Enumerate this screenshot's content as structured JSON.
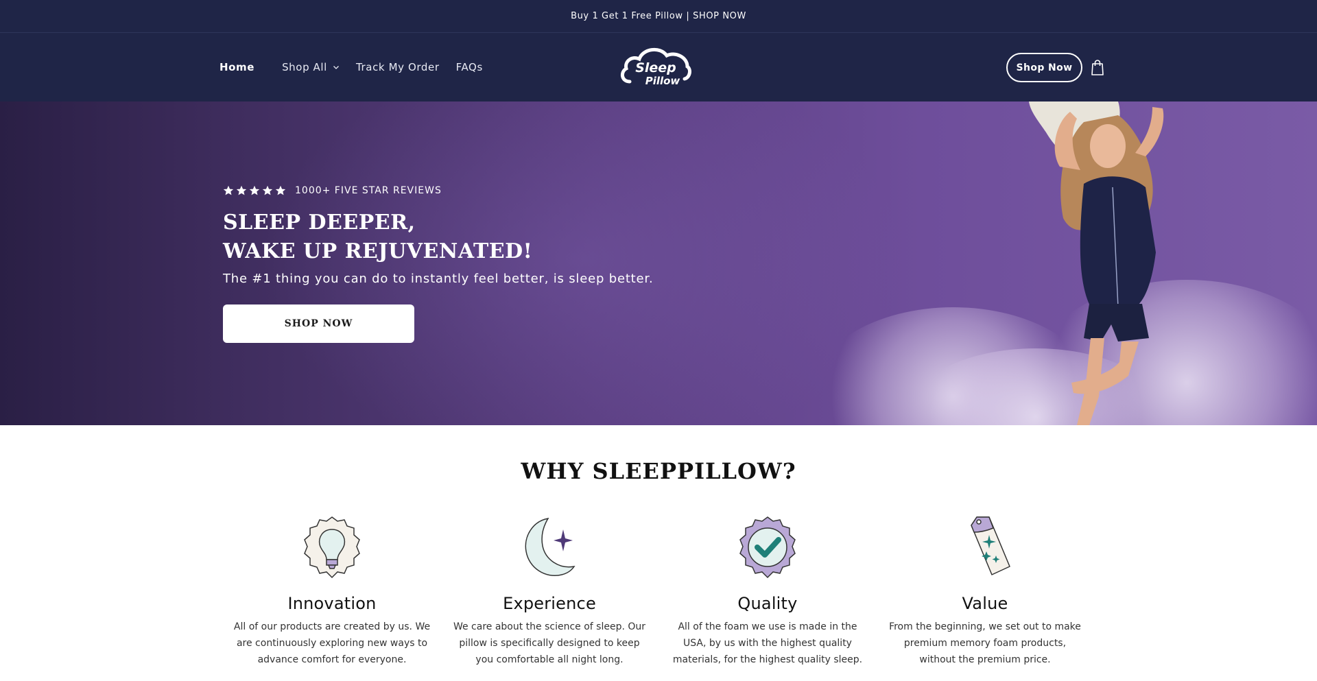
{
  "announcement": {
    "text": "Buy 1 Get 1 Free Pillow | SHOP NOW"
  },
  "header": {
    "nav": [
      {
        "label": "Home"
      },
      {
        "label": "Shop All"
      },
      {
        "label": "Track My Order"
      },
      {
        "label": "FAQs"
      }
    ],
    "logo_text": "Sleep Pillow",
    "shop_button": "Shop Now",
    "cart_icon": "shopping-bag-icon"
  },
  "hero": {
    "rating_stars": 5,
    "reviews_text": "1000+ FIVE STAR REVIEWS",
    "title_line1": "SLEEP DEEPER,",
    "title_line2": "WAKE UP REJUVENATED!",
    "subtitle": "The #1 thing you can do to instantly feel better, is sleep better.",
    "button": "SHOP NOW"
  },
  "why": {
    "title": "WHY SLEEPPILLOW?",
    "features": [
      {
        "icon": "lightbulb-icon",
        "title": "Innovation",
        "text": "All of our products are created by us. We are continuously exploring new ways to advance comfort for everyone."
      },
      {
        "icon": "moon-star-icon",
        "title": "Experience",
        "text": "We care about the science of sleep. Our pillow is specifically designed to keep you comfortable all night long."
      },
      {
        "icon": "quality-badge-icon",
        "title": "Quality",
        "text": "All of the foam we use is made in the USA, by us with the highest quality materials, for the highest quality sleep."
      },
      {
        "icon": "price-tag-icon",
        "title": "Value",
        "text": "From the beginning, we set out to make premium memory foam products, without the premium price."
      }
    ]
  },
  "colors": {
    "header_bg": "#1f2547",
    "accent_purple": "#5b3f82",
    "icon_teal": "#1f7f78",
    "icon_lavender": "#b9a8d6"
  }
}
